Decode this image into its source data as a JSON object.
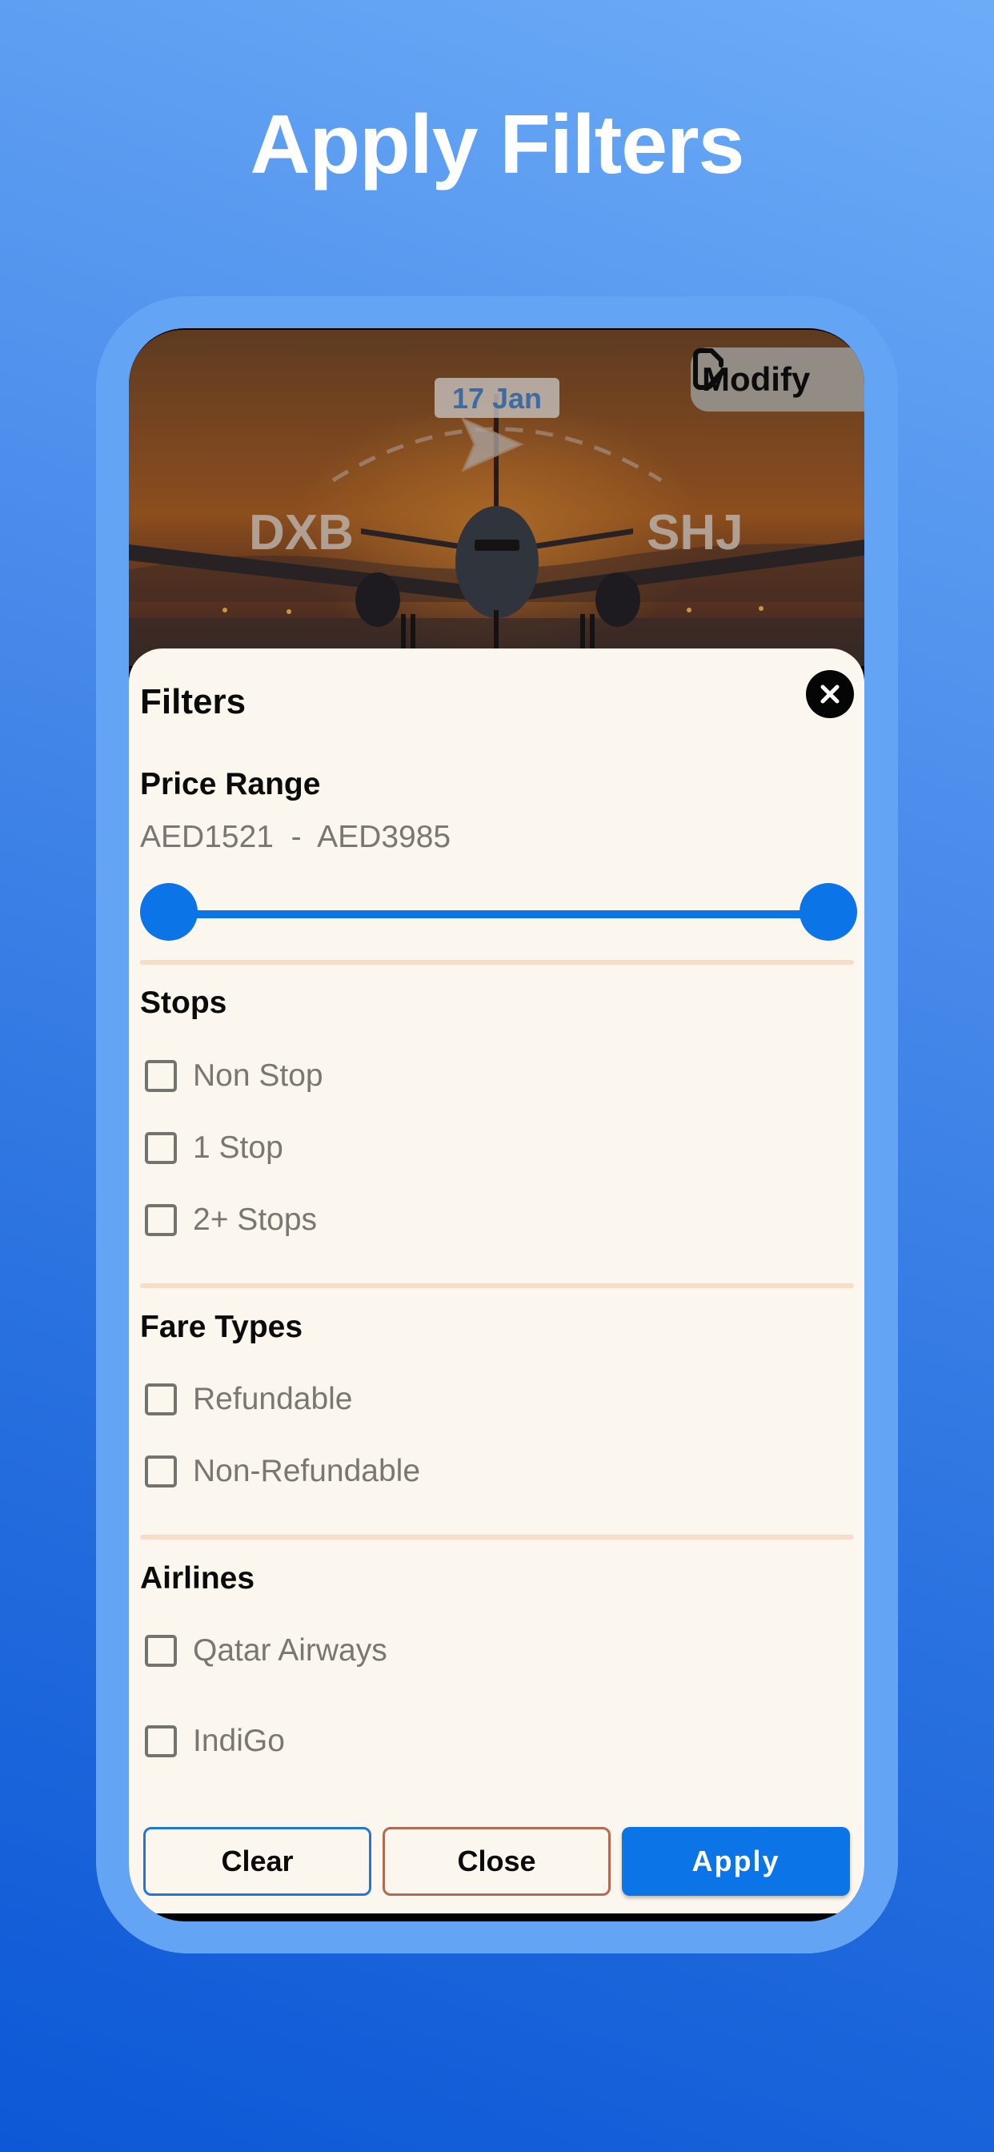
{
  "promo": {
    "title": "Apply Filters"
  },
  "hero": {
    "date": "17 Jan",
    "origin": "DXB",
    "destination": "SHJ",
    "modify_label": "Modify"
  },
  "filters": {
    "title": "Filters",
    "price_range": {
      "heading": "Price Range",
      "min_label": "AED1521",
      "separator": "-",
      "max_label": "AED3985",
      "min_value": 1521,
      "max_value": 3985,
      "selected_fraction_low": 0.0,
      "selected_fraction_high": 1.0
    },
    "stops": {
      "heading": "Stops",
      "options": [
        {
          "label": "Non Stop",
          "checked": false
        },
        {
          "label": "1 Stop",
          "checked": false
        },
        {
          "label": "2+ Stops",
          "checked": false
        }
      ]
    },
    "fare_types": {
      "heading": "Fare Types",
      "options": [
        {
          "label": "Refundable",
          "checked": false
        },
        {
          "label": "Non-Refundable",
          "checked": false
        }
      ]
    },
    "airlines": {
      "heading": "Airlines",
      "options": [
        {
          "label": "Qatar Airways",
          "checked": false
        },
        {
          "label": "IndiGo",
          "checked": false
        }
      ]
    },
    "buttons": {
      "clear": "Clear",
      "close": "Close",
      "apply": "Apply"
    }
  },
  "colors": {
    "accent": "#0B74E6",
    "sheet_background": "#FBF7EE",
    "divider": "#F8DCC8",
    "close_button_border": "#B26A50"
  }
}
